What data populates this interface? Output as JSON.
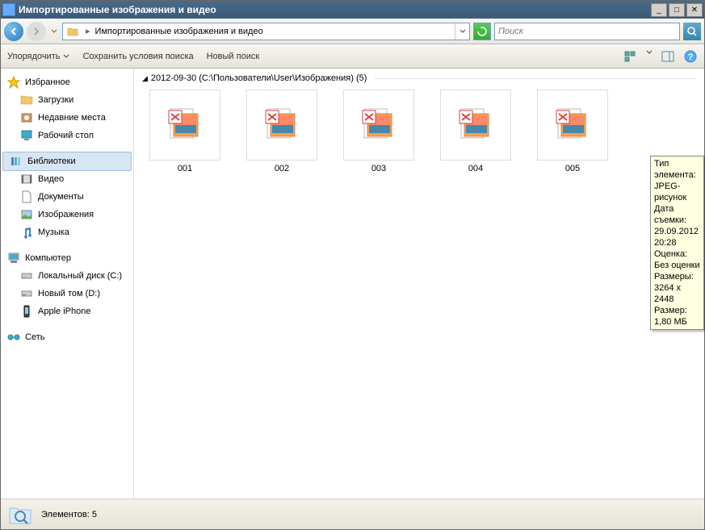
{
  "window": {
    "title": "Импортированные изображения и видео"
  },
  "address": {
    "text": "Импортированные изображения и видео"
  },
  "search": {
    "placeholder": "Поиск"
  },
  "toolbar": {
    "organize": "Упорядочить",
    "save_search": "Сохранить условия поиска",
    "new_search": "Новый поиск"
  },
  "sidebar": {
    "favorites": {
      "label": "Избранное"
    },
    "downloads": {
      "label": "Загрузки"
    },
    "recent": {
      "label": "Недавние места"
    },
    "desktop": {
      "label": "Рабочий стол"
    },
    "libraries": {
      "label": "Библиотеки"
    },
    "videos": {
      "label": "Видео"
    },
    "documents": {
      "label": "Документы"
    },
    "pictures": {
      "label": "Изображения"
    },
    "music": {
      "label": "Музыка"
    },
    "computer": {
      "label": "Компьютер"
    },
    "localdisk": {
      "label": "Локальный диск (C:)"
    },
    "newvol": {
      "label": "Новый том (D:)"
    },
    "iphone": {
      "label": "Apple iPhone"
    },
    "network": {
      "label": "Сеть"
    }
  },
  "group": {
    "header": "2012-09-30 (C:\\Пользователи\\User\\Изображения) (5)"
  },
  "items": [
    {
      "label": "001"
    },
    {
      "label": "002"
    },
    {
      "label": "003"
    },
    {
      "label": "004"
    },
    {
      "label": "005"
    }
  ],
  "tooltip": {
    "line1": "Тип элемента: JPEG-рисунок",
    "line2": "Дата съемки: 29.09.2012 20:28",
    "line3": "Оценка: Без оценки",
    "line4": "Размеры: 3264 x 2448",
    "line5": "Размер: 1,80 МБ"
  },
  "status": {
    "text": "Элементов: 5"
  }
}
